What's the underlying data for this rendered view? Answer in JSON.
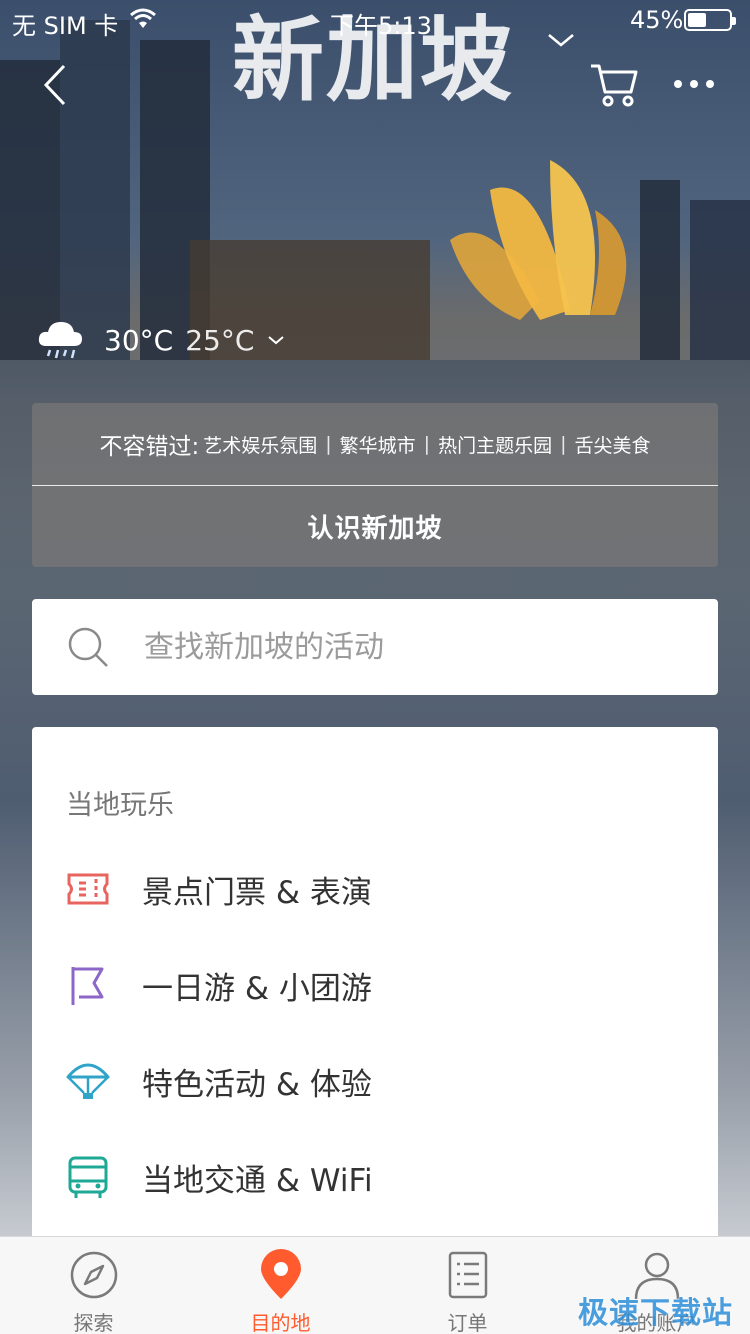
{
  "status_bar": {
    "carrier": "无 SIM 卡",
    "time": "下午5:13",
    "battery_percent": "45%",
    "battery_level": 0.45
  },
  "header": {
    "city": "新加坡",
    "back_icon": "chevron-left-icon",
    "cart_icon": "cart-icon",
    "more_icon": "more-dots-icon"
  },
  "weather": {
    "icon": "rain-cloud-icon",
    "high": "30°C",
    "low": "25°C"
  },
  "intro": {
    "lead": "不容错过:",
    "highlights": [
      "艺术娱乐氛围",
      "繁华城市",
      "热门主题乐园",
      "舌尖美食"
    ],
    "separator": "|",
    "learn_button": "认识新加坡"
  },
  "search": {
    "placeholder": "查找新加坡的活动"
  },
  "local_fun": {
    "heading": "当地玩乐",
    "items": [
      {
        "label": "景点门票 & 表演",
        "icon": "ticket-icon",
        "color": "#e8645e"
      },
      {
        "label": "一日游 & 小团游",
        "icon": "flag-icon",
        "color": "#8c67c8"
      },
      {
        "label": "特色活动 & 体验",
        "icon": "parachute-icon",
        "color": "#2fa3c8"
      },
      {
        "label": "当地交通 & WiFi",
        "icon": "bus-icon",
        "color": "#1ea896"
      }
    ]
  },
  "tabbar": {
    "tabs": [
      {
        "label": "探索",
        "icon": "compass-icon",
        "active": false
      },
      {
        "label": "目的地",
        "icon": "location-pin-icon",
        "active": true
      },
      {
        "label": "订单",
        "icon": "order-list-icon",
        "active": false
      },
      {
        "label": "我的账户",
        "icon": "user-icon",
        "active": false
      }
    ],
    "active_color": "#ff5b2e"
  },
  "watermark": "极速下载站"
}
